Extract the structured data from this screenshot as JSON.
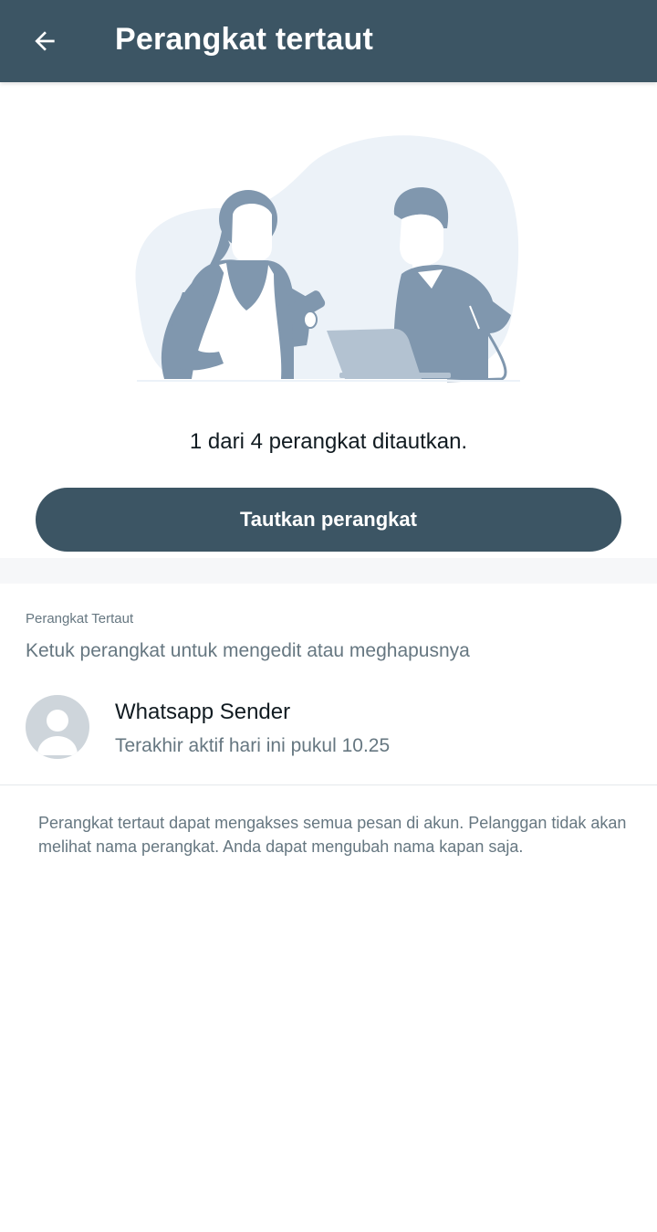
{
  "appbar": {
    "title": "Perangkat tertaut",
    "back_icon": "arrow-left-icon"
  },
  "hero": {
    "illustration": "two-people-with-devices-illustration",
    "count_text": "1 dari 4 perangkat ditautkan."
  },
  "actions": {
    "link_device_label": "Tautkan perangkat"
  },
  "linked_section": {
    "header": "Perangkat Tertaut",
    "subtitle": "Ketuk perangkat untuk mengedit atau meghapusnya",
    "devices": [
      {
        "name": "Whatsapp Sender",
        "status": "Terakhir aktif hari ini pukul 10.25",
        "avatar_icon": "default-avatar-icon"
      }
    ]
  },
  "footer": {
    "note": "Perangkat tertaut dapat mengakses semua pesan di akun. Pelanggan tidak akan melihat nama perangkat. Anda dapat mengubah nama kapan saja."
  },
  "colors": {
    "appbar": "#3c5564",
    "primary_text": "#111b21",
    "secondary_text": "#667781",
    "illustration_fill": "#8097ae",
    "illustration_bg": "#ecf2f8"
  }
}
